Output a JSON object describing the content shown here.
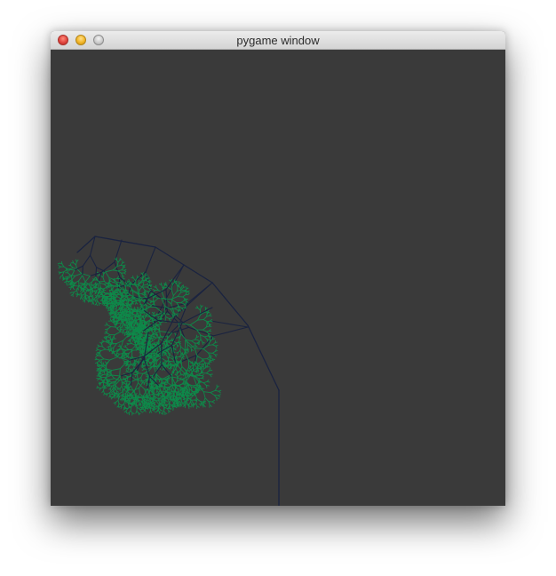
{
  "window": {
    "title": "pygame window",
    "background": "#3a3a3a",
    "buttons": [
      "close",
      "minimize",
      "zoom"
    ]
  },
  "scene": {
    "description_icon": "fractal-tree",
    "trunk_color": "#1a2340",
    "foliage_color": "#0e8a4a"
  }
}
